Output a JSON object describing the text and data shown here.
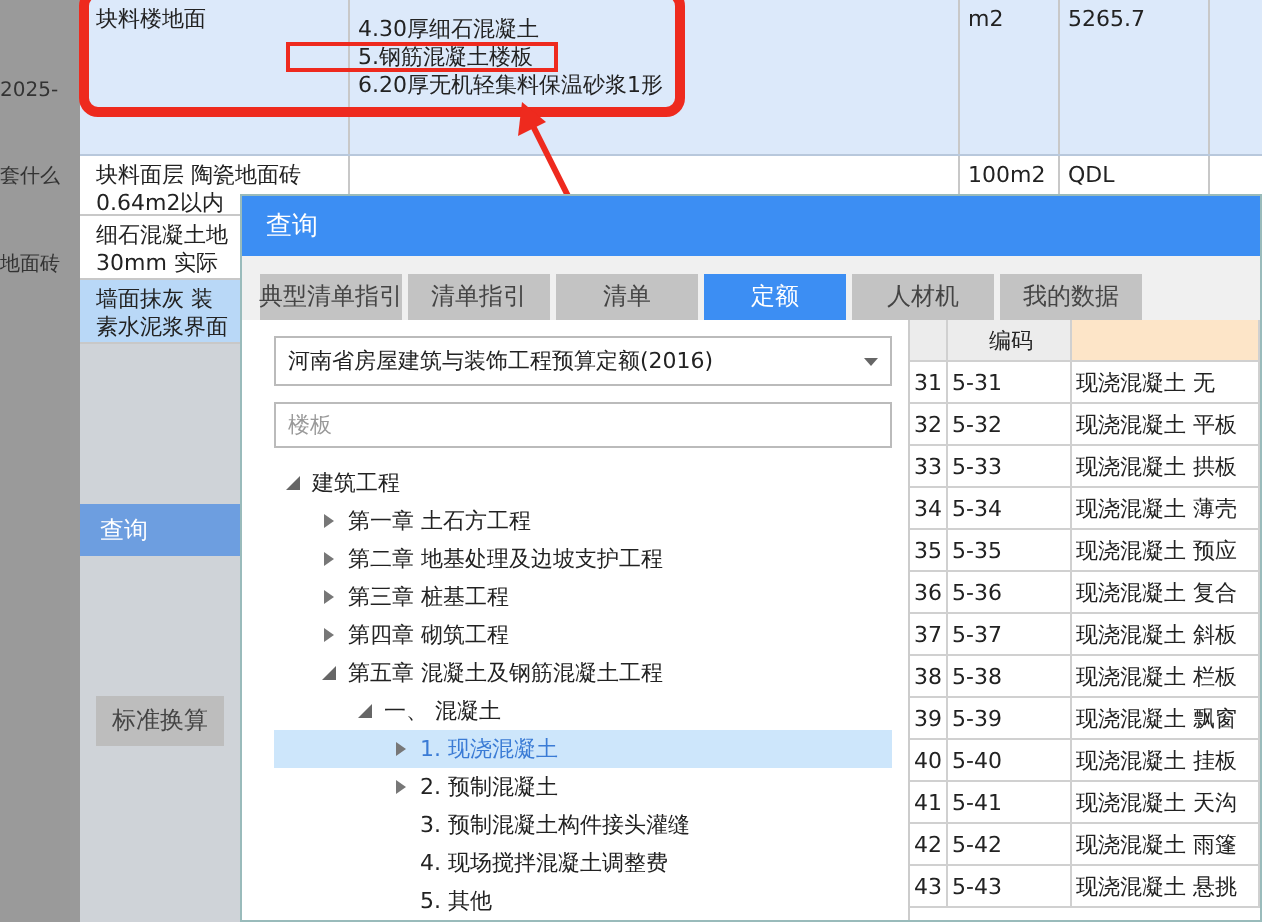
{
  "side_fragments": [
    "2025-",
    "套什么",
    "地面砖"
  ],
  "background_table": {
    "rows": [
      {
        "name": [
          "块料楼地面"
        ],
        "description": [
          {
            "text": "4.30厚细石混凝土",
            "framed": false
          },
          {
            "text": "5.钢筋混凝土楼板",
            "framed": true
          },
          {
            "text": "6.20厚无机轻集料保温砂浆1形",
            "framed": false
          }
        ],
        "unit": "m2",
        "quantity": "5265.7",
        "selected": false,
        "highlighted": true
      },
      {
        "name": [
          "块料面层 陶瓷地面砖",
          "0.64m2以内"
        ],
        "description": [],
        "unit": "100m2",
        "quantity": "QDL",
        "selected": false,
        "highlighted": false
      },
      {
        "name": [
          "细石混凝土地",
          "30mm 实际"
        ],
        "description": [],
        "selected": false,
        "highlighted": false
      },
      {
        "name": [
          "墙面抹灰 装",
          "素水泥浆界面"
        ],
        "description": [],
        "selected": true,
        "highlighted": false
      }
    ]
  },
  "behind_window": {
    "title": "查询",
    "tab": "标准换算"
  },
  "dialog": {
    "title": "查询",
    "tabs": [
      {
        "label": "典型清单指引",
        "selected": false
      },
      {
        "label": "清单指引",
        "selected": false
      },
      {
        "label": "清单",
        "selected": false
      },
      {
        "label": "定额",
        "selected": true
      },
      {
        "label": "人材机",
        "selected": false
      },
      {
        "label": "我的数据",
        "selected": false
      }
    ],
    "library": "河南省房屋建筑与装饰工程预算定额(2016)",
    "search": {
      "placeholder": "楼板"
    },
    "tree": [
      {
        "label": "建筑工程",
        "expanded": true,
        "selected": false,
        "children": [
          {
            "label": "第一章 土石方工程",
            "expanded": false,
            "selected": false
          },
          {
            "label": "第二章 地基处理及边坡支护工程",
            "expanded": false,
            "selected": false
          },
          {
            "label": "第三章 桩基工程",
            "expanded": false,
            "selected": false
          },
          {
            "label": "第四章 砌筑工程",
            "expanded": false,
            "selected": false
          },
          {
            "label": "第五章 混凝土及钢筋混凝土工程",
            "expanded": true,
            "selected": false,
            "children": [
              {
                "label": "一、 混凝土",
                "expanded": true,
                "selected": false,
                "children": [
                  {
                    "label": "1. 现浇混凝土",
                    "expanded": false,
                    "selected": true
                  },
                  {
                    "label": "2. 预制混凝土",
                    "expanded": false,
                    "selected": false
                  },
                  {
                    "label": "3. 预制混凝土构件接头灌缝",
                    "selected": false
                  },
                  {
                    "label": "4. 现场搅拌混凝土调整费",
                    "selected": false
                  },
                  {
                    "label": "5. 其他",
                    "selected": false
                  }
                ]
              }
            ]
          }
        ]
      }
    ],
    "grid": {
      "columns": [
        "编码"
      ],
      "rows": [
        {
          "index": "31",
          "code": "5-31",
          "name": "现浇混凝土 无"
        },
        {
          "index": "32",
          "code": "5-32",
          "name": "现浇混凝土 平板"
        },
        {
          "index": "33",
          "code": "5-33",
          "name": "现浇混凝土 拱板"
        },
        {
          "index": "34",
          "code": "5-34",
          "name": "现浇混凝土 薄壳"
        },
        {
          "index": "35",
          "code": "5-35",
          "name": "现浇混凝土 预应"
        },
        {
          "index": "36",
          "code": "5-36",
          "name": "现浇混凝土 复合"
        },
        {
          "index": "37",
          "code": "5-37",
          "name": "现浇混凝土 斜板"
        },
        {
          "index": "38",
          "code": "5-38",
          "name": "现浇混凝土 栏板"
        },
        {
          "index": "39",
          "code": "5-39",
          "name": "现浇混凝土 飘窗"
        },
        {
          "index": "40",
          "code": "5-40",
          "name": "现浇混凝土 挂板"
        },
        {
          "index": "41",
          "code": "5-41",
          "name": "现浇混凝土 天沟"
        },
        {
          "index": "42",
          "code": "5-42",
          "name": "现浇混凝土 雨篷"
        },
        {
          "index": "43",
          "code": "5-43",
          "name": "现浇混凝土 悬挑"
        }
      ]
    }
  }
}
